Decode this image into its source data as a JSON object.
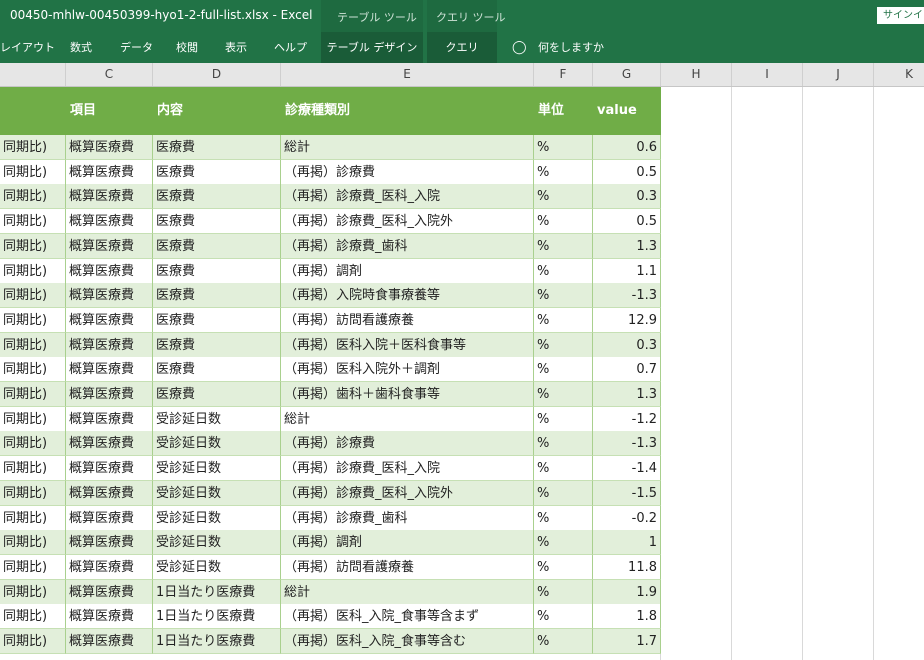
{
  "titlebar": {
    "title": "00450-mhlw-00450399-hyo1-2-full-list.xlsx  -  Excel",
    "table_tools": "テーブル ツール",
    "query_tools": "クエリ ツール",
    "signin": "サインイン"
  },
  "ribbon": {
    "tabs": [
      "レイアウト",
      "数式",
      "データ",
      "校閲",
      "表示",
      "ヘルプ",
      "テーブル デザイン",
      "クエリ"
    ],
    "active_tab": "テーブル デザイン",
    "tell_me": "何をしますか"
  },
  "column_headers": [
    "C",
    "D",
    "E",
    "F",
    "G",
    "H",
    "I",
    "J",
    "K"
  ],
  "table": {
    "headers": {
      "c": "項目",
      "d": "内容",
      "e": "診療種類別",
      "f": "単位",
      "g": "value"
    },
    "rows": [
      {
        "b": "同期比)",
        "c": "概算医療費",
        "d": "医療費",
        "e": "総計",
        "f": "%",
        "g": "0.6"
      },
      {
        "b": "同期比)",
        "c": "概算医療費",
        "d": "医療費",
        "e": "（再掲）診療費",
        "f": "%",
        "g": "0.5"
      },
      {
        "b": "同期比)",
        "c": "概算医療費",
        "d": "医療費",
        "e": "（再掲）診療費_医科_入院",
        "f": "%",
        "g": "0.3"
      },
      {
        "b": "同期比)",
        "c": "概算医療費",
        "d": "医療費",
        "e": "（再掲）診療費_医科_入院外",
        "f": "%",
        "g": "0.5"
      },
      {
        "b": "同期比)",
        "c": "概算医療費",
        "d": "医療費",
        "e": "（再掲）診療費_歯科",
        "f": "%",
        "g": "1.3"
      },
      {
        "b": "同期比)",
        "c": "概算医療費",
        "d": "医療費",
        "e": "（再掲）調剤",
        "f": "%",
        "g": "1.1"
      },
      {
        "b": "同期比)",
        "c": "概算医療費",
        "d": "医療費",
        "e": "（再掲）入院時食事療養等",
        "f": "%",
        "g": "-1.3"
      },
      {
        "b": "同期比)",
        "c": "概算医療費",
        "d": "医療費",
        "e": "（再掲）訪問看護療養",
        "f": "%",
        "g": "12.9"
      },
      {
        "b": "同期比)",
        "c": "概算医療費",
        "d": "医療費",
        "e": "（再掲）医科入院＋医科食事等",
        "f": "%",
        "g": "0.3"
      },
      {
        "b": "同期比)",
        "c": "概算医療費",
        "d": "医療費",
        "e": "（再掲）医科入院外＋調剤",
        "f": "%",
        "g": "0.7"
      },
      {
        "b": "同期比)",
        "c": "概算医療費",
        "d": "医療費",
        "e": "（再掲）歯科＋歯科食事等",
        "f": "%",
        "g": "1.3"
      },
      {
        "b": "同期比)",
        "c": "概算医療費",
        "d": "受診延日数",
        "e": "総計",
        "f": "%",
        "g": "-1.2"
      },
      {
        "b": "同期比)",
        "c": "概算医療費",
        "d": "受診延日数",
        "e": "（再掲）診療費",
        "f": "%",
        "g": "-1.3"
      },
      {
        "b": "同期比)",
        "c": "概算医療費",
        "d": "受診延日数",
        "e": "（再掲）診療費_医科_入院",
        "f": "%",
        "g": "-1.4"
      },
      {
        "b": "同期比)",
        "c": "概算医療費",
        "d": "受診延日数",
        "e": "（再掲）診療費_医科_入院外",
        "f": "%",
        "g": "-1.5"
      },
      {
        "b": "同期比)",
        "c": "概算医療費",
        "d": "受診延日数",
        "e": "（再掲）診療費_歯科",
        "f": "%",
        "g": "-0.2"
      },
      {
        "b": "同期比)",
        "c": "概算医療費",
        "d": "受診延日数",
        "e": "（再掲）調剤",
        "f": "%",
        "g": "1"
      },
      {
        "b": "同期比)",
        "c": "概算医療費",
        "d": "受診延日数",
        "e": "（再掲）訪問看護療養",
        "f": "%",
        "g": "11.8"
      },
      {
        "b": "同期比)",
        "c": "概算医療費",
        "d": "1日当たり医療費",
        "e": "総計",
        "f": "%",
        "g": "1.9"
      },
      {
        "b": "同期比)",
        "c": "概算医療費",
        "d": "1日当たり医療費",
        "e": "（再掲）医科_入院_食事等含まず",
        "f": "%",
        "g": "1.8"
      },
      {
        "b": "同期比)",
        "c": "概算医療費",
        "d": "1日当たり医療費",
        "e": "（再掲）医科_入院_食事等含む",
        "f": "%",
        "g": "1.7"
      }
    ]
  }
}
